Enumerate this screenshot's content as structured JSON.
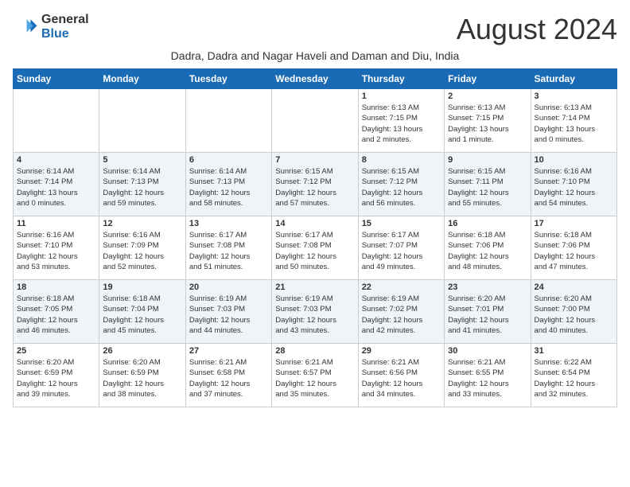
{
  "header": {
    "logo_line1": "General",
    "logo_line2": "Blue",
    "month": "August 2024",
    "subtitle": "Dadra, Dadra and Nagar Haveli and Daman and Diu, India"
  },
  "days_of_week": [
    "Sunday",
    "Monday",
    "Tuesday",
    "Wednesday",
    "Thursday",
    "Friday",
    "Saturday"
  ],
  "weeks": [
    [
      {
        "day": "",
        "info": ""
      },
      {
        "day": "",
        "info": ""
      },
      {
        "day": "",
        "info": ""
      },
      {
        "day": "",
        "info": ""
      },
      {
        "day": "1",
        "info": "Sunrise: 6:13 AM\nSunset: 7:15 PM\nDaylight: 13 hours\nand 2 minutes."
      },
      {
        "day": "2",
        "info": "Sunrise: 6:13 AM\nSunset: 7:15 PM\nDaylight: 13 hours\nand 1 minute."
      },
      {
        "day": "3",
        "info": "Sunrise: 6:13 AM\nSunset: 7:14 PM\nDaylight: 13 hours\nand 0 minutes."
      }
    ],
    [
      {
        "day": "4",
        "info": "Sunrise: 6:14 AM\nSunset: 7:14 PM\nDaylight: 13 hours\nand 0 minutes."
      },
      {
        "day": "5",
        "info": "Sunrise: 6:14 AM\nSunset: 7:13 PM\nDaylight: 12 hours\nand 59 minutes."
      },
      {
        "day": "6",
        "info": "Sunrise: 6:14 AM\nSunset: 7:13 PM\nDaylight: 12 hours\nand 58 minutes."
      },
      {
        "day": "7",
        "info": "Sunrise: 6:15 AM\nSunset: 7:12 PM\nDaylight: 12 hours\nand 57 minutes."
      },
      {
        "day": "8",
        "info": "Sunrise: 6:15 AM\nSunset: 7:12 PM\nDaylight: 12 hours\nand 56 minutes."
      },
      {
        "day": "9",
        "info": "Sunrise: 6:15 AM\nSunset: 7:11 PM\nDaylight: 12 hours\nand 55 minutes."
      },
      {
        "day": "10",
        "info": "Sunrise: 6:16 AM\nSunset: 7:10 PM\nDaylight: 12 hours\nand 54 minutes."
      }
    ],
    [
      {
        "day": "11",
        "info": "Sunrise: 6:16 AM\nSunset: 7:10 PM\nDaylight: 12 hours\nand 53 minutes."
      },
      {
        "day": "12",
        "info": "Sunrise: 6:16 AM\nSunset: 7:09 PM\nDaylight: 12 hours\nand 52 minutes."
      },
      {
        "day": "13",
        "info": "Sunrise: 6:17 AM\nSunset: 7:08 PM\nDaylight: 12 hours\nand 51 minutes."
      },
      {
        "day": "14",
        "info": "Sunrise: 6:17 AM\nSunset: 7:08 PM\nDaylight: 12 hours\nand 50 minutes."
      },
      {
        "day": "15",
        "info": "Sunrise: 6:17 AM\nSunset: 7:07 PM\nDaylight: 12 hours\nand 49 minutes."
      },
      {
        "day": "16",
        "info": "Sunrise: 6:18 AM\nSunset: 7:06 PM\nDaylight: 12 hours\nand 48 minutes."
      },
      {
        "day": "17",
        "info": "Sunrise: 6:18 AM\nSunset: 7:06 PM\nDaylight: 12 hours\nand 47 minutes."
      }
    ],
    [
      {
        "day": "18",
        "info": "Sunrise: 6:18 AM\nSunset: 7:05 PM\nDaylight: 12 hours\nand 46 minutes."
      },
      {
        "day": "19",
        "info": "Sunrise: 6:18 AM\nSunset: 7:04 PM\nDaylight: 12 hours\nand 45 minutes."
      },
      {
        "day": "20",
        "info": "Sunrise: 6:19 AM\nSunset: 7:03 PM\nDaylight: 12 hours\nand 44 minutes."
      },
      {
        "day": "21",
        "info": "Sunrise: 6:19 AM\nSunset: 7:03 PM\nDaylight: 12 hours\nand 43 minutes."
      },
      {
        "day": "22",
        "info": "Sunrise: 6:19 AM\nSunset: 7:02 PM\nDaylight: 12 hours\nand 42 minutes."
      },
      {
        "day": "23",
        "info": "Sunrise: 6:20 AM\nSunset: 7:01 PM\nDaylight: 12 hours\nand 41 minutes."
      },
      {
        "day": "24",
        "info": "Sunrise: 6:20 AM\nSunset: 7:00 PM\nDaylight: 12 hours\nand 40 minutes."
      }
    ],
    [
      {
        "day": "25",
        "info": "Sunrise: 6:20 AM\nSunset: 6:59 PM\nDaylight: 12 hours\nand 39 minutes."
      },
      {
        "day": "26",
        "info": "Sunrise: 6:20 AM\nSunset: 6:59 PM\nDaylight: 12 hours\nand 38 minutes."
      },
      {
        "day": "27",
        "info": "Sunrise: 6:21 AM\nSunset: 6:58 PM\nDaylight: 12 hours\nand 37 minutes."
      },
      {
        "day": "28",
        "info": "Sunrise: 6:21 AM\nSunset: 6:57 PM\nDaylight: 12 hours\nand 35 minutes."
      },
      {
        "day": "29",
        "info": "Sunrise: 6:21 AM\nSunset: 6:56 PM\nDaylight: 12 hours\nand 34 minutes."
      },
      {
        "day": "30",
        "info": "Sunrise: 6:21 AM\nSunset: 6:55 PM\nDaylight: 12 hours\nand 33 minutes."
      },
      {
        "day": "31",
        "info": "Sunrise: 6:22 AM\nSunset: 6:54 PM\nDaylight: 12 hours\nand 32 minutes."
      }
    ]
  ]
}
